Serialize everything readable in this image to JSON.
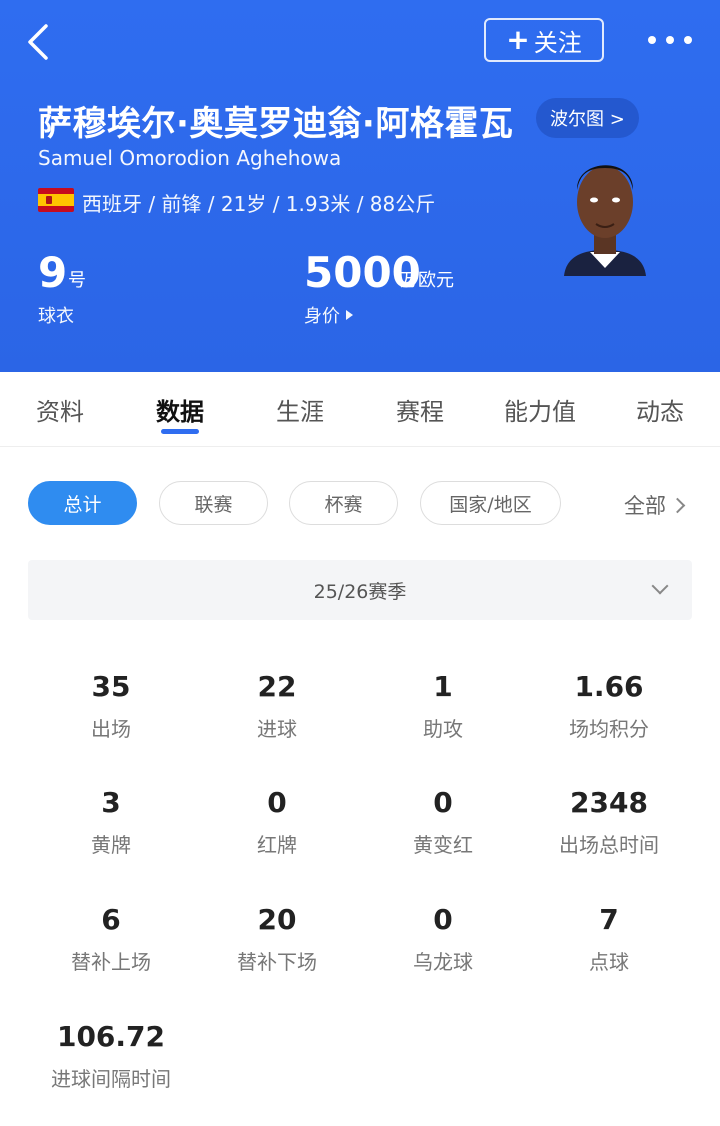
{
  "header": {
    "follow_label": "关注",
    "name_cn": "萨穆埃尔·奥莫罗迪翁·阿格霍瓦",
    "name_en": "Samuel Omorodion Aghehowa",
    "heatmap_label": "波尔图 >",
    "info": "西班牙 / 前锋 / 21岁 / 1.93米 / 88公斤",
    "jersey": {
      "number": "9",
      "unit": "号",
      "label": "球衣"
    },
    "market_value": {
      "number": "5000",
      "unit": "万欧元",
      "label": "身价"
    }
  },
  "tabs": [
    {
      "label": "资料"
    },
    {
      "label": "数据"
    },
    {
      "label": "生涯"
    },
    {
      "label": "赛程"
    },
    {
      "label": "能力值"
    },
    {
      "label": "动态"
    }
  ],
  "filters": [
    {
      "label": "总计"
    },
    {
      "label": "联赛"
    },
    {
      "label": "杯赛"
    },
    {
      "label": "国家/地区"
    }
  ],
  "all_label": "全部",
  "season": "25/26赛季",
  "stats": [
    {
      "value": "35",
      "label": "出场"
    },
    {
      "value": "22",
      "label": "进球"
    },
    {
      "value": "1",
      "label": "助攻"
    },
    {
      "value": "1.66",
      "label": "场均积分"
    },
    {
      "value": "3",
      "label": "黄牌"
    },
    {
      "value": "0",
      "label": "红牌"
    },
    {
      "value": "0",
      "label": "黄变红"
    },
    {
      "value": "2348",
      "label": "出场总时间"
    },
    {
      "value": "6",
      "label": "替补上场"
    },
    {
      "value": "20",
      "label": "替补下场"
    },
    {
      "value": "0",
      "label": "乌龙球"
    },
    {
      "value": "7",
      "label": "点球"
    },
    {
      "value": "106.72",
      "label": "进球间隔时间"
    }
  ],
  "colors": {
    "header_bg": "#2f6df0",
    "accent": "#2f8cf0"
  }
}
